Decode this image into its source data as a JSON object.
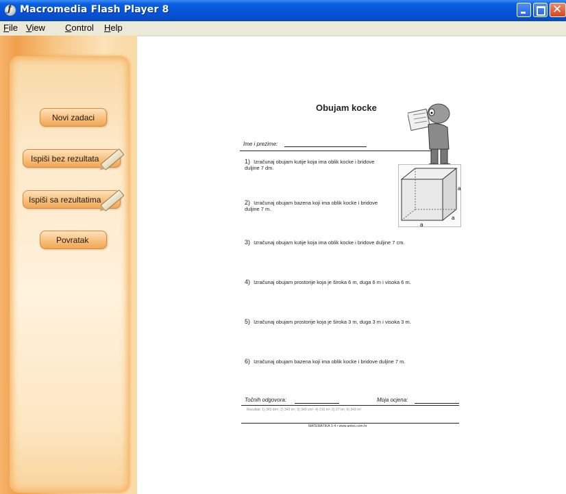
{
  "window": {
    "title": "Macromedia Flash Player 8"
  },
  "menu": [
    "File",
    "View",
    "Control",
    "Help"
  ],
  "sidebar": {
    "buttons": [
      {
        "label": "Novi zadaci"
      },
      {
        "label": "Ispiši bez rezultata"
      },
      {
        "label": "Ispiši sa rezultatima"
      },
      {
        "label": "Povratak"
      }
    ]
  },
  "worksheet": {
    "title": "Obujam kocke",
    "name_label": "Ime i prezime:",
    "cube_labels": [
      "a",
      "a",
      "a"
    ],
    "tasks": [
      {
        "num": "1)",
        "text": "Izračunaj obujam kutije koja ima oblik kocke i bridove duljine 7 dm."
      },
      {
        "num": "2)",
        "text": "Izračunaj obujam bazena koji ima oblik kocke i bridove duljine 7 m."
      },
      {
        "num": "3)",
        "text": "Izračunaj obujam kutije koja ima oblik kocke i bridove duljine 7 cm."
      },
      {
        "num": "4)",
        "text": "Izračunaj obujam prostorije koja je široka 6 m, duga 6 m i visoka 6 m."
      },
      {
        "num": "5)",
        "text": "Izračunaj obujam prostorije koja je široka 3 m, duga 3 m i visoka 3 m."
      },
      {
        "num": "6)",
        "text": "Izračunaj obujam bazena koji ima oblik kocke i bridove duljine 7 m."
      }
    ],
    "correct_label": "Točnih odgovora:",
    "grade_label": "Moja ocjena:",
    "results_text": "Rezultati: 1) 343 dm³, 2) 343 m³, 3) 343 cm³, 4) 216 m³, 5) 27 m³, 6) 343 m³",
    "footer_text": "MATEMATIKA 1-4 • www.antos.com.hr"
  }
}
